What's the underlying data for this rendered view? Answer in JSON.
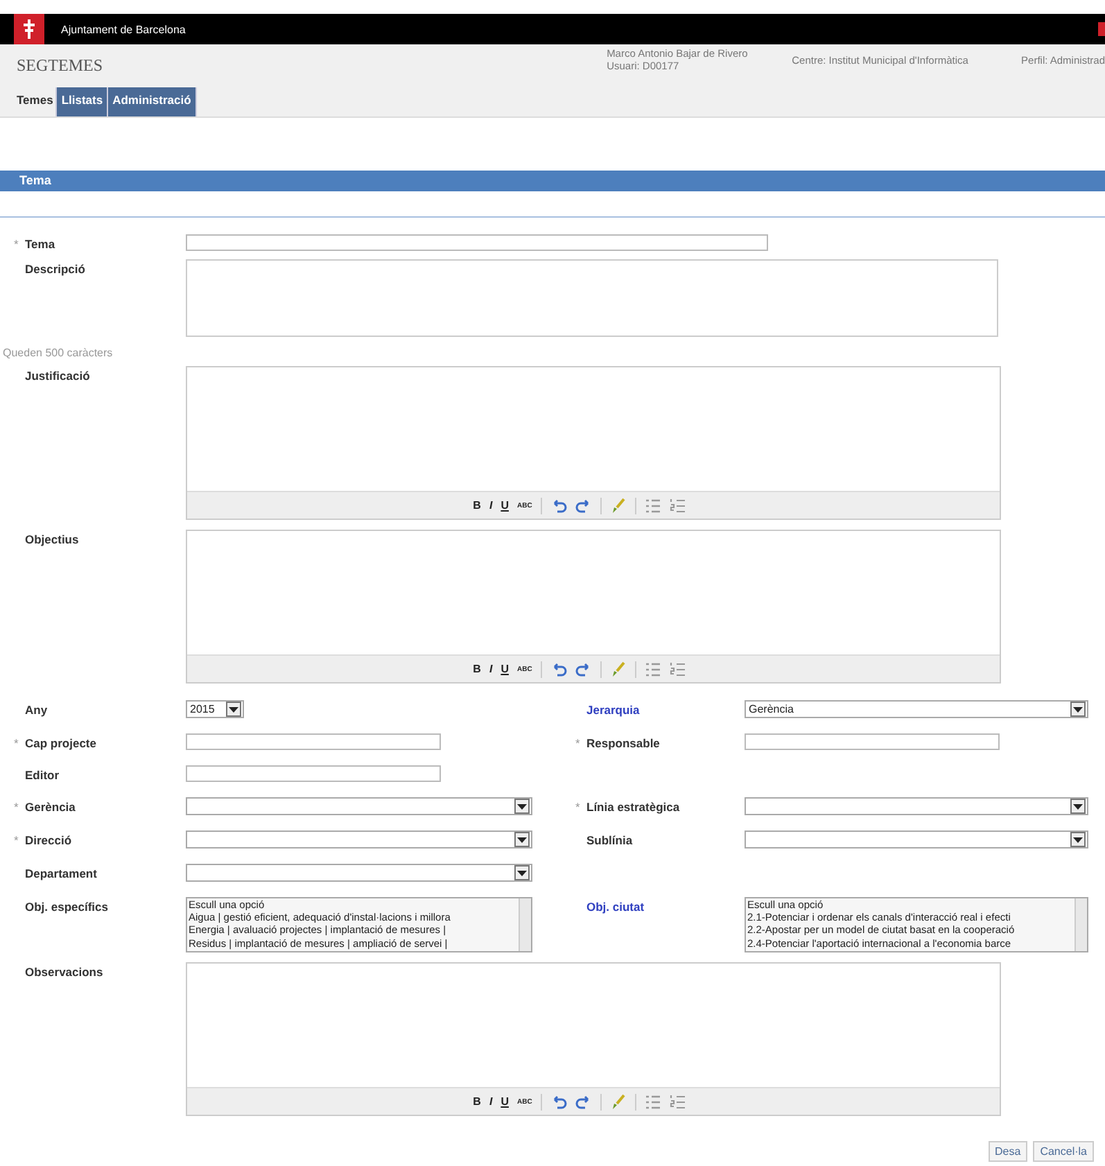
{
  "header": {
    "organization": "Ajuntament de Barcelona",
    "app_title": "SEGTEMES",
    "user_name": "Marco Antonio Bajar de Rivero",
    "user_id": "Usuari: D00177",
    "centre": "Centre: Institut Municipal d'Informàtica",
    "profile": "Perfil: Administrad"
  },
  "tabs": [
    {
      "label": "Temes",
      "selected": true
    },
    {
      "label": "Llistats",
      "selected": false
    },
    {
      "label": "Administració",
      "selected": false
    }
  ],
  "section_title": "Tema",
  "rows": [
    {
      "left": {
        "kind": "long_input",
        "label": "Tema",
        "required_mark": "*"
      }
    },
    {
      "left": {
        "kind": "textarea",
        "label": "Descripció"
      }
    },
    {
      "left": {
        "kind": "counter",
        "label": "Queden 500 caràcters"
      }
    },
    {
      "left": {
        "kind": "editor",
        "label": "Justificació",
        "toolbar": [
          "B",
          "I",
          "U",
          "ABC"
        ]
      }
    },
    {
      "left": {
        "kind": "editor",
        "label": "Objectius",
        "toolbar": [
          "B",
          "I",
          "U",
          "ABC"
        ]
      }
    },
    {
      "left": {
        "kind": "year_select",
        "label": "Any",
        "value": "2015"
      },
      "right": {
        "kind": "select",
        "label": "Jerarquia",
        "link": true,
        "value": "Gerència"
      }
    },
    {
      "left": {
        "kind": "input",
        "label": "Cap projecte",
        "required_mark": "*"
      },
      "right": {
        "kind": "input",
        "label": "Responsable",
        "required_mark": "*"
      }
    },
    {
      "left": {
        "kind": "input",
        "label": "Editor"
      }
    },
    {
      "left": {
        "kind": "select",
        "label": "Gerència",
        "required_mark": "*"
      },
      "right": {
        "kind": "select",
        "label": "Línia estratègica",
        "required_mark": "*"
      }
    },
    {
      "left": {
        "kind": "select",
        "label": "Direcció",
        "required_mark": "*"
      },
      "right": {
        "kind": "select",
        "label": "Sublínia"
      }
    },
    {
      "left": {
        "kind": "select",
        "label": "Departament"
      }
    },
    {
      "left": {
        "kind": "listbox",
        "label": "Obj. específics",
        "options": [
          "Escull una opció",
          "Aigua | gestió eficient, adequació d'instal·lacions i millora",
          "Energia | avaluació projectes | implantació de mesures |",
          "Residus | implantació de mesures | ampliació de servei |"
        ]
      },
      "right": {
        "kind": "listbox",
        "label": "Obj. ciutat",
        "link": true,
        "options": [
          "Escull una opció",
          "2.1-Potenciar i ordenar els canals d'interacció real i efecti",
          "2.2-Apostar per un model de ciutat basat en la cooperació",
          "2.4-Potenciar l'aportació internacional a l'economia barce"
        ]
      }
    },
    {
      "left": {
        "kind": "editor",
        "label": "Observacions",
        "toolbar": [
          "B",
          "I",
          "U",
          "ABC"
        ]
      }
    }
  ],
  "buttons": [
    "Desa",
    "Cancel·la"
  ]
}
